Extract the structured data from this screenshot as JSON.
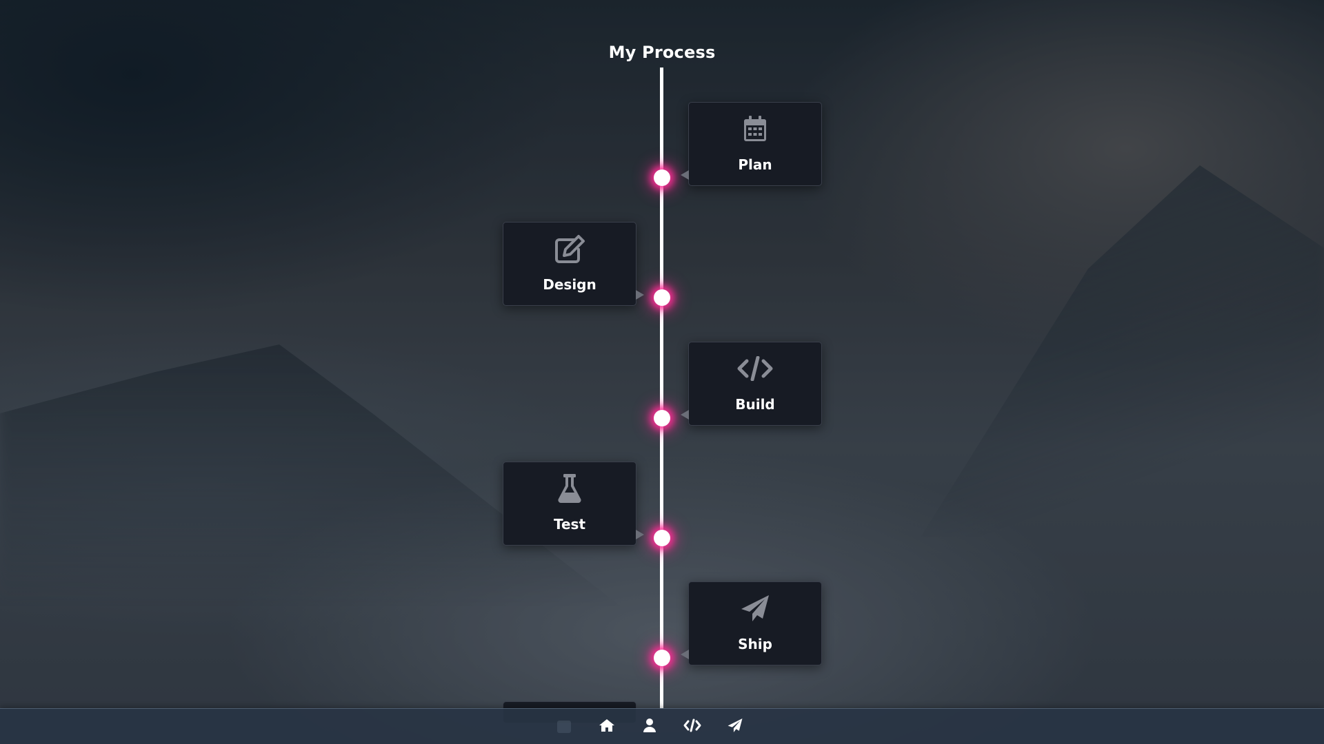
{
  "page": {
    "title": "My Process"
  },
  "timeline": {
    "steps": [
      {
        "label": "Plan",
        "icon": "calendar-icon",
        "side": "right"
      },
      {
        "label": "Design",
        "icon": "edit-icon",
        "side": "left"
      },
      {
        "label": "Build",
        "icon": "code-icon",
        "side": "right"
      },
      {
        "label": "Test",
        "icon": "flask-icon",
        "side": "left"
      },
      {
        "label": "Ship",
        "icon": "paper-plane-icon",
        "side": "right"
      }
    ]
  },
  "nav": {
    "items": [
      {
        "icon": "home-icon"
      },
      {
        "icon": "user-icon"
      },
      {
        "icon": "code-icon"
      },
      {
        "icon": "paper-plane-icon"
      }
    ]
  },
  "colors": {
    "accent_glow": "#ff2d96",
    "card_background": "#171b24",
    "nav_background": "#283444",
    "line": "#ffffff"
  }
}
